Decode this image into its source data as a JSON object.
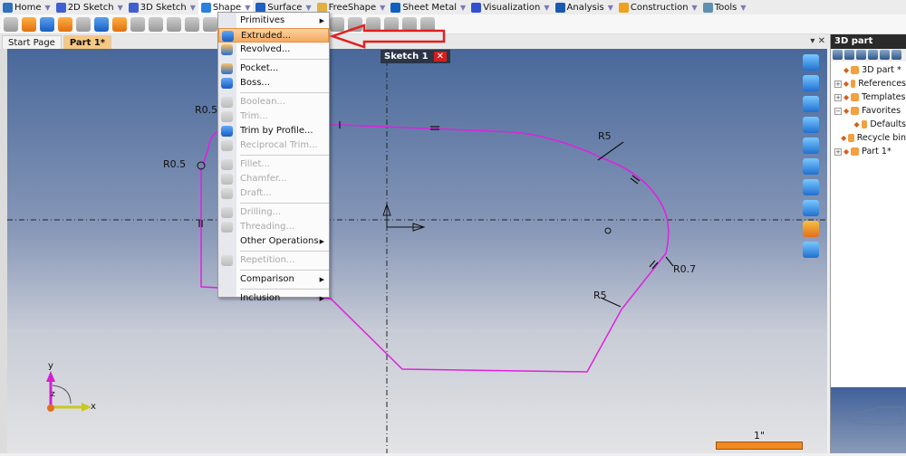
{
  "menubar": [
    {
      "label": "Home",
      "icon": "home-icon",
      "color": "#3070c0"
    },
    {
      "label": "2D Sketch",
      "icon": "pencil-icon",
      "color": "#4060d0"
    },
    {
      "label": "3D Sketch",
      "icon": "pencil-3d-icon",
      "color": "#4060d0"
    },
    {
      "label": "Shape",
      "icon": "shape-icon",
      "color": "#2a80e0"
    },
    {
      "label": "Surface",
      "icon": "surface-icon",
      "color": "#2060c0"
    },
    {
      "label": "FreeShape",
      "icon": "freeshape-icon",
      "color": "#e0b040"
    },
    {
      "label": "Sheet Metal",
      "icon": "sheet-metal-icon",
      "color": "#1060c0"
    },
    {
      "label": "Visualization",
      "icon": "visualization-icon",
      "color": "#3050d0"
    },
    {
      "label": "Analysis",
      "icon": "analysis-icon",
      "color": "#1a5ab0"
    },
    {
      "label": "Construction",
      "icon": "construction-icon",
      "color": "#f0a020"
    },
    {
      "label": "Tools",
      "icon": "tools-icon",
      "color": "#6090b0"
    }
  ],
  "tabs": [
    {
      "label": "Start Page"
    },
    {
      "label": "Part 1*"
    }
  ],
  "tab_controls": "▾ ✕",
  "sketch_tab": {
    "label": "Sketch 1",
    "close": "✕"
  },
  "dropdown": [
    {
      "label": "Primitives",
      "submenu": true,
      "enabled": true,
      "icon": ""
    },
    {
      "label": "Extruded...",
      "enabled": true,
      "highlighted": true,
      "icon": "extruded-icon"
    },
    {
      "label": "Revolved...",
      "enabled": true,
      "icon": "revolved-icon"
    },
    {
      "sep": true
    },
    {
      "label": "Pocket...",
      "enabled": true,
      "icon": "pocket-icon"
    },
    {
      "label": "Boss...",
      "enabled": true,
      "icon": "boss-icon"
    },
    {
      "sep": true
    },
    {
      "label": "Boolean...",
      "enabled": false,
      "icon": "boolean-icon"
    },
    {
      "label": "Trim...",
      "enabled": false,
      "icon": "trim-icon"
    },
    {
      "label": "Trim by Profile...",
      "enabled": true,
      "icon": "trim-by-profile-icon"
    },
    {
      "label": "Reciprocal Trim...",
      "enabled": false,
      "icon": "reciprocal-trim-icon"
    },
    {
      "sep": true
    },
    {
      "label": "Fillet...",
      "enabled": false,
      "icon": "fillet-icon"
    },
    {
      "label": "Chamfer...",
      "enabled": false,
      "icon": "chamfer-icon"
    },
    {
      "label": "Draft...",
      "enabled": false,
      "icon": "draft-icon"
    },
    {
      "sep": true
    },
    {
      "label": "Drilling...",
      "enabled": false,
      "icon": "drilling-icon"
    },
    {
      "label": "Threading...",
      "enabled": false,
      "icon": "threading-icon"
    },
    {
      "label": "Other Operations",
      "submenu": true,
      "enabled": true,
      "icon": ""
    },
    {
      "sep": true
    },
    {
      "label": "Repetition...",
      "enabled": false,
      "icon": "repetition-icon"
    },
    {
      "sep": true
    },
    {
      "label": "Comparison",
      "submenu": true,
      "enabled": true,
      "icon": ""
    },
    {
      "sep": true
    },
    {
      "label": "Inclusion",
      "submenu": true,
      "enabled": true,
      "icon": ""
    }
  ],
  "panel": {
    "title": "3D part",
    "tree": [
      {
        "label": "3D part *",
        "level": 0,
        "expander": ""
      },
      {
        "label": "References",
        "level": 0,
        "expander": "+"
      },
      {
        "label": "Templates",
        "level": 0,
        "expander": "+"
      },
      {
        "label": "Favorites",
        "level": 0,
        "expander": "−"
      },
      {
        "label": "Defaults",
        "level": 1,
        "expander": ""
      },
      {
        "label": "Recycle bin",
        "level": 0,
        "expander": ""
      },
      {
        "label": "Part 1*",
        "level": 0,
        "expander": "+"
      }
    ]
  },
  "sketch": {
    "dimensions": [
      "R0.5",
      "R0.5",
      "R5",
      "R0.7",
      "R5"
    ],
    "profile_color": "#e020e0",
    "axis_labels": {
      "x": "x",
      "y": "y",
      "z": "z"
    }
  },
  "scale": {
    "label": "1\"",
    "color": "#f08a20"
  },
  "annotation_arrow_color": "#e02020"
}
